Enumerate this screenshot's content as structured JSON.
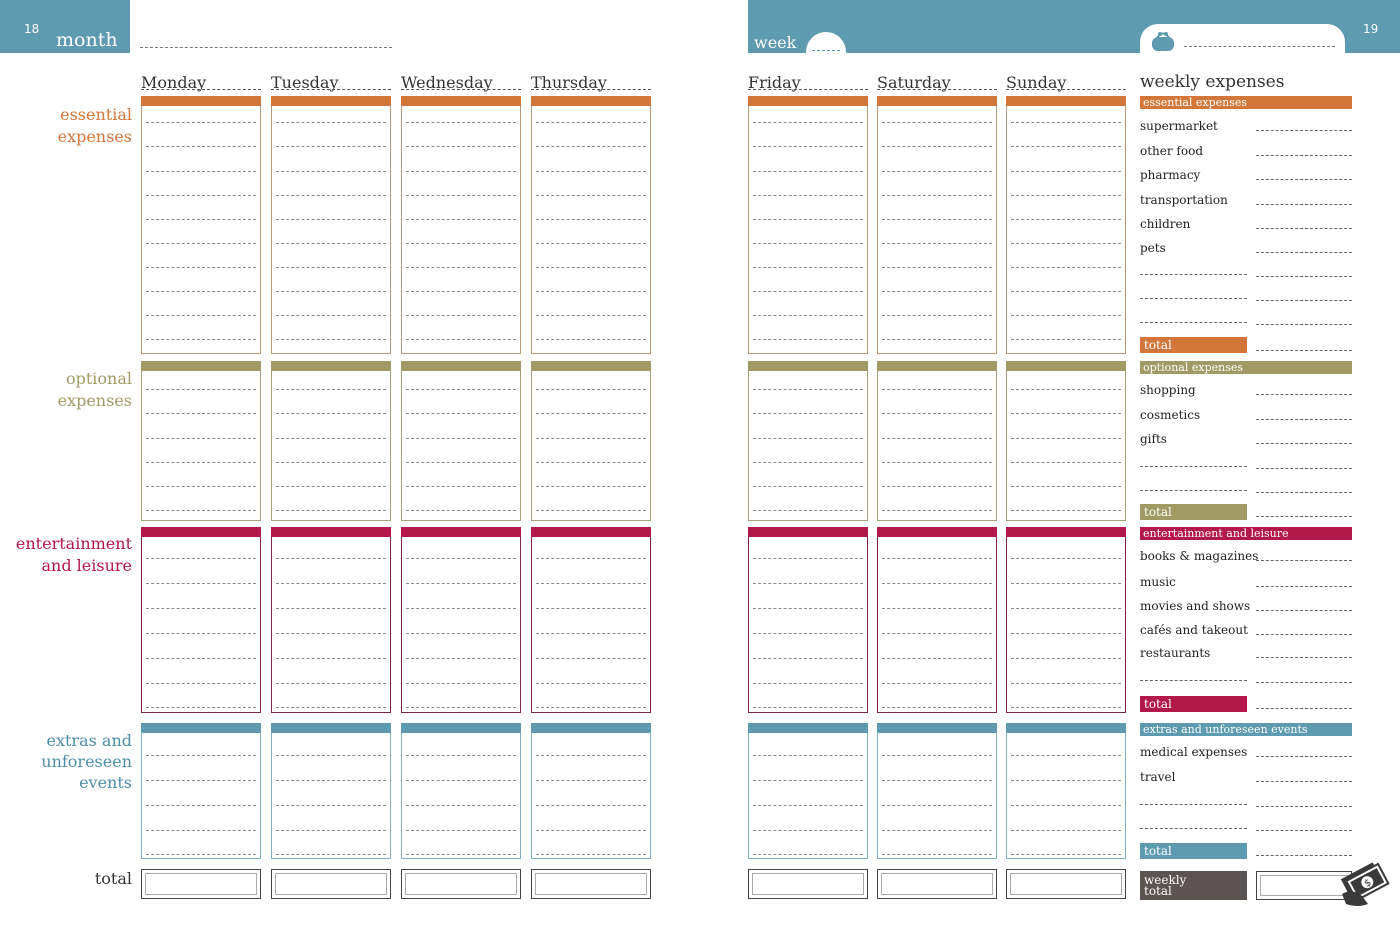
{
  "header": {
    "left_page_number": "18",
    "right_page_number": "19",
    "month_label": "month",
    "week_label": "week"
  },
  "left_days": [
    "Monday",
    "Tuesday",
    "Wednesday",
    "Thursday"
  ],
  "right_days": [
    "Friday",
    "Saturday",
    "Sunday"
  ],
  "categories": {
    "essential": [
      "essential",
      "expenses"
    ],
    "optional": [
      "optional",
      "expenses"
    ],
    "entertainment": [
      "entertainment",
      "and leisure"
    ],
    "extras": [
      "extras and",
      "unforeseen",
      "events"
    ],
    "total": "total"
  },
  "weekly": {
    "title": "weekly expenses",
    "essential": {
      "header": "essential expenses",
      "items": [
        "supermarket",
        "other food",
        "pharmacy",
        "transportation",
        "children",
        "pets"
      ],
      "total": "total"
    },
    "optional": {
      "header": "optional expenses",
      "items": [
        "shopping",
        "cosmetics",
        "gifts"
      ],
      "total": "total"
    },
    "entertainment": {
      "header": "entertainment and leisure",
      "items": [
        "books & magazines",
        "music",
        "movies and shows",
        "cafés and takeout",
        "restaurants"
      ],
      "total": "total"
    },
    "extras": {
      "header": "extras and unforeseen events",
      "items": [
        "medical expenses",
        "travel"
      ],
      "total": "total"
    },
    "weekly_total": [
      "weekly",
      "total"
    ]
  },
  "colors": {
    "teal": "#5e9ab0",
    "essential": "#d2763a",
    "optional": "#a19a64",
    "entertainment": "#b3184a",
    "extras": "#5e9ab0",
    "weekly_total": "#5b5452"
  },
  "icons": {
    "purse": "purse-icon",
    "money": "money-bills-icon"
  }
}
